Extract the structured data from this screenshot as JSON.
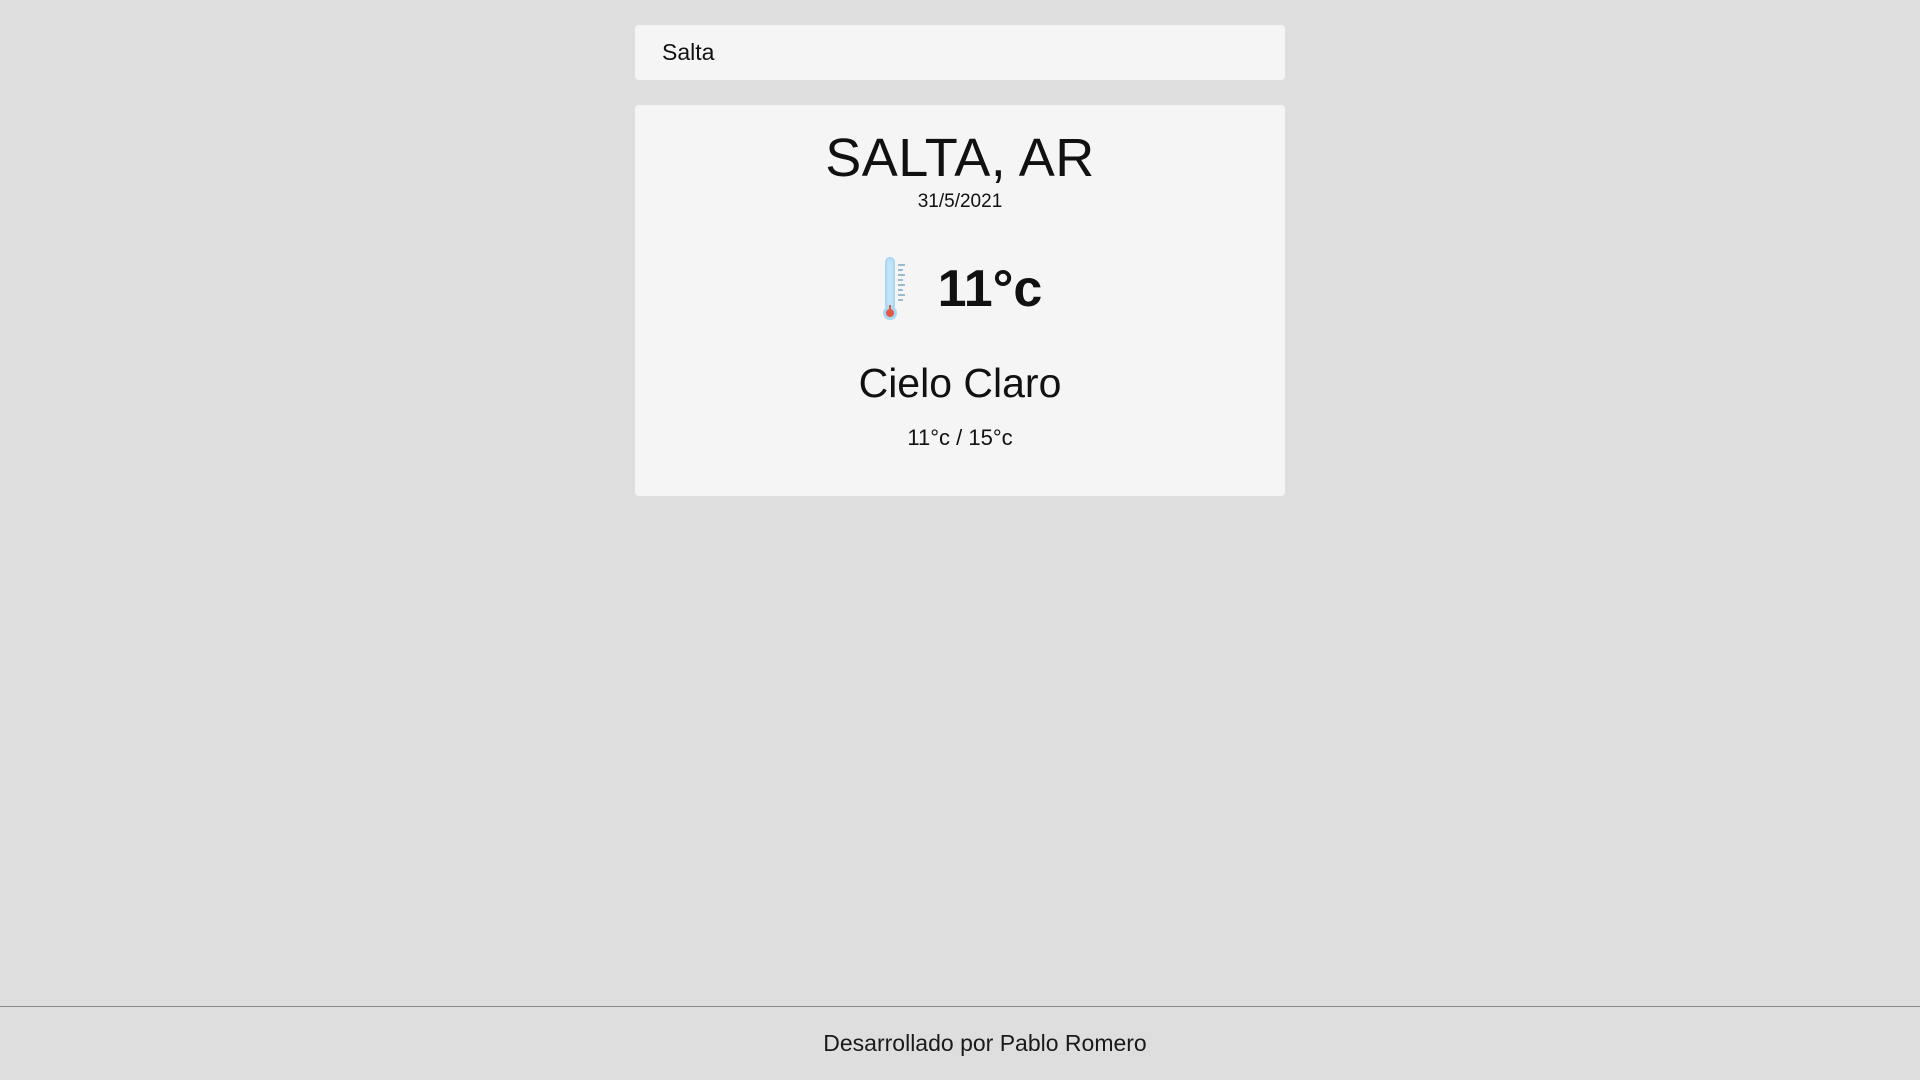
{
  "search": {
    "value": "Salta"
  },
  "weather": {
    "city": "SALTA, AR",
    "date": "31/5/2021",
    "icon": "thermometer-icon",
    "temperature": "11°c",
    "description": "Cielo Claro",
    "min_max": "11°c / 15°c"
  },
  "footer": {
    "credit": "Desarrollado por Pablo Romero"
  },
  "colors": {
    "background": "#dedede",
    "card": "#f4f5f4",
    "thermometer_tube": "#a9d8f2",
    "thermometer_bulb": "#e05a4a"
  }
}
